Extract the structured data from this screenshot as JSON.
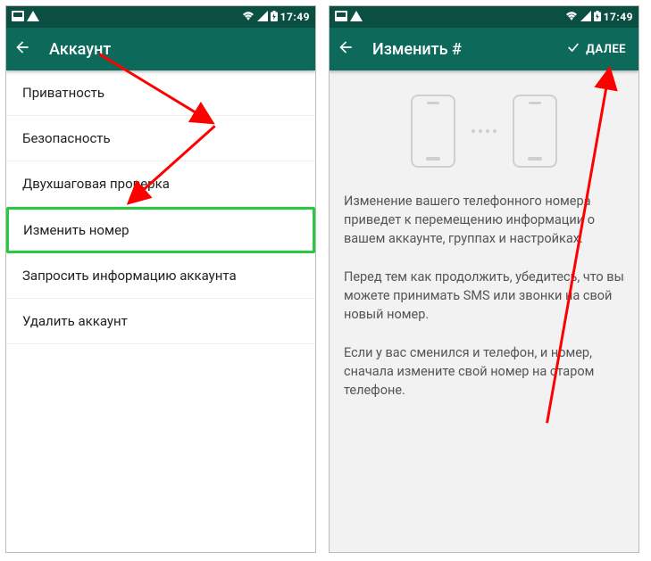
{
  "status": {
    "time": "17:49"
  },
  "left": {
    "title": "Аккаунт",
    "items": [
      "Приватность",
      "Безопасность",
      "Двухшаговая проверка",
      "Изменить номер",
      "Запросить информацию аккаунта",
      "Удалить аккаунт"
    ],
    "highlightIndex": 3
  },
  "right": {
    "title": "Изменить #",
    "next": "ДАЛЕЕ",
    "para1": "Изменение вашего телефонного номера приведет к перемещению информации о вашем аккаунте, группах и настройках.",
    "para2": "Перед тем как продолжить, убедитесь, что вы можете принимать SMS или звонки на свой новый номер.",
    "para3": "Если у вас сменился и телефон, и номер, сначала измените свой номер на старом телефоне."
  }
}
